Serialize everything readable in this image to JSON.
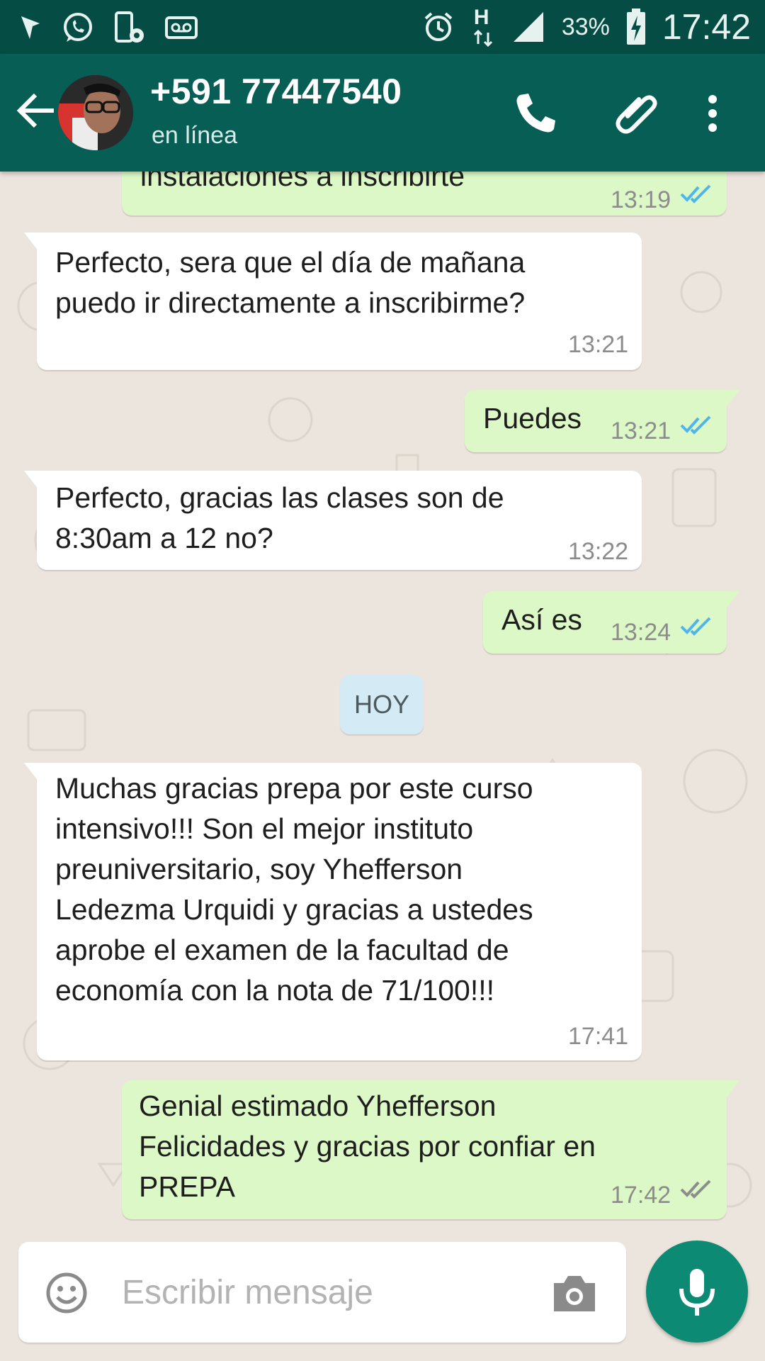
{
  "status_bar": {
    "battery_percent": "33%",
    "time": "17:42",
    "network": "H",
    "icons": [
      "location-icon",
      "whatsapp-icon",
      "phone-settings-icon",
      "voicemail-icon",
      "alarm-icon",
      "signal-icon",
      "battery-charging-icon"
    ]
  },
  "header": {
    "contact_name": "+591 77447540",
    "status": "en línea",
    "actions": [
      "call-icon",
      "attach-icon",
      "more-icon"
    ]
  },
  "messages": [
    {
      "dir": "out",
      "text": "instalaciones a inscribirte",
      "time": "13:19",
      "ticks": "read"
    },
    {
      "dir": "in",
      "text": "Perfecto, sera que el día de mañana\npuedo ir directamente a inscribirme?",
      "time": "13:21"
    },
    {
      "dir": "out",
      "text": "Puedes",
      "time": "13:21",
      "ticks": "read"
    },
    {
      "dir": "in",
      "text": "Perfecto, gracias las clases son de\n8:30am a 12 no?",
      "time": "13:22"
    },
    {
      "dir": "out",
      "text": "Así es",
      "time": "13:24",
      "ticks": "read"
    },
    {
      "dir": "in",
      "text": "Muchas gracias prepa por este curso\nintensivo!!! Son el mejor instituto\npreuniversitario, soy Yhefferson\nLedezma Urquidi y gracias a ustedes\naprobe el examen de la facultad de\neconomía con la nota de 71/100!!!",
      "time": "17:41"
    },
    {
      "dir": "out",
      "text": "Genial estimado Yhefferson\nFelicidades y gracias por confiar en\nPREPA",
      "time": "17:42",
      "ticks": "delivered"
    }
  ],
  "day_divider": "HOY",
  "composer": {
    "placeholder": "Escribir mensaje"
  },
  "colors": {
    "status_bar": "#054d44",
    "app_bar": "#075e54",
    "outgoing_bubble": "#dcf8c6",
    "incoming_bubble": "#ffffff",
    "read_ticks": "#4fb6ec",
    "fab": "#0d8a74"
  }
}
